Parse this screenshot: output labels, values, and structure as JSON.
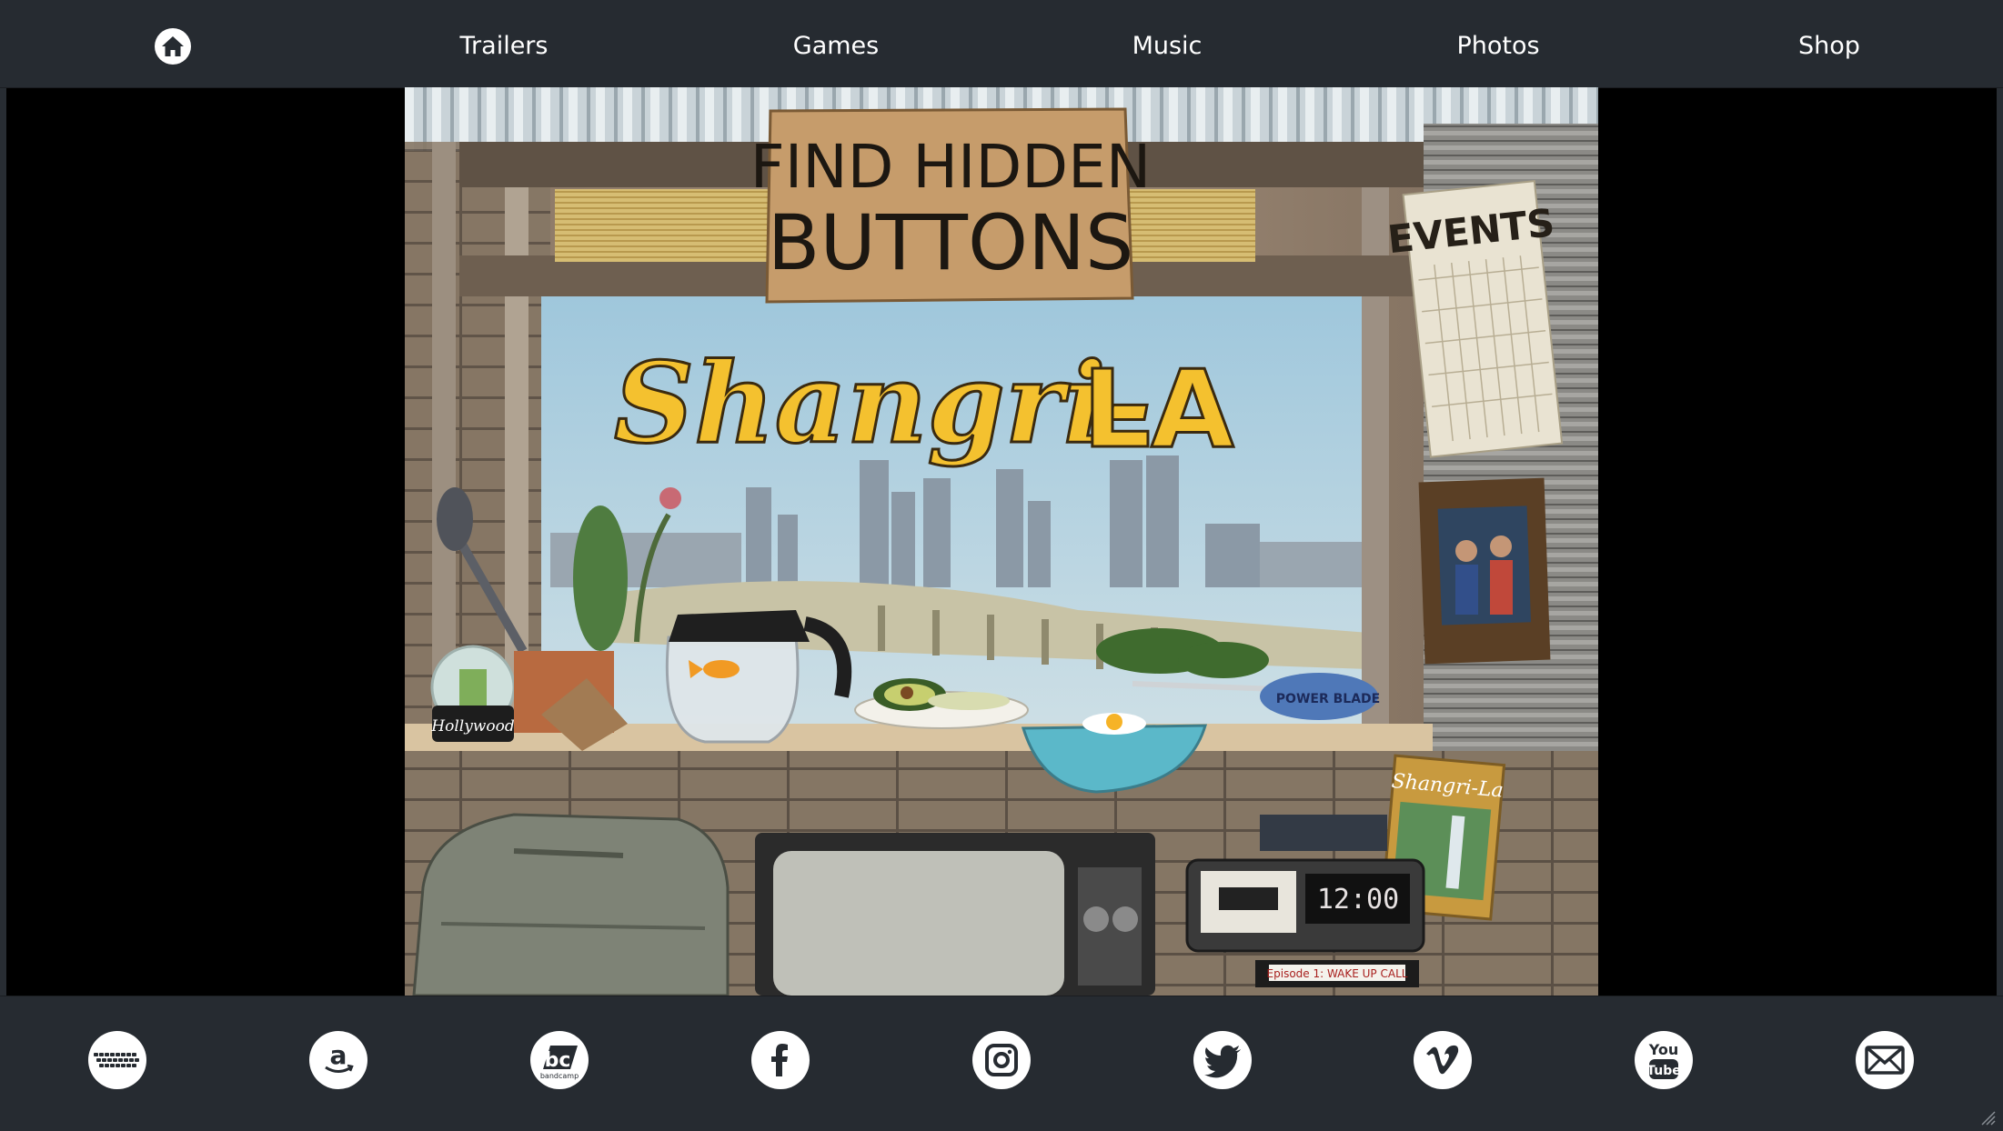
{
  "nav": {
    "home_icon": "home-icon",
    "items": [
      {
        "label": "Trailers"
      },
      {
        "label": "Games"
      },
      {
        "label": "Music"
      },
      {
        "label": "Photos"
      },
      {
        "label": "Shop"
      }
    ]
  },
  "scene": {
    "sign_line1": "FIND HIDDEN",
    "sign_line2": "BUTTONS",
    "title_script": "Shangri-",
    "title_caps": "LA",
    "calendar_title": "EVENTS",
    "snowglobe_text": "Hollywood",
    "clock_time": "12:00",
    "tape_label": "Episode 1: WAKE UP CALL",
    "book_title": "Shangri-La",
    "knife_brand": "POWER BLADE"
  },
  "social": [
    {
      "icon": "keyboard-icon"
    },
    {
      "icon": "amazon-icon"
    },
    {
      "icon": "bandcamp-icon",
      "text": "bc",
      "sub": "bandcamp"
    },
    {
      "icon": "facebook-icon"
    },
    {
      "icon": "instagram-icon"
    },
    {
      "icon": "twitter-icon"
    },
    {
      "icon": "vimeo-icon"
    },
    {
      "icon": "youtube-icon",
      "text1": "You",
      "text2": "Tube"
    },
    {
      "icon": "mail-icon"
    }
  ],
  "colors": {
    "bar": "#262b31",
    "title_yellow": "#f4c12f",
    "cardboard": "#c69c6b"
  }
}
